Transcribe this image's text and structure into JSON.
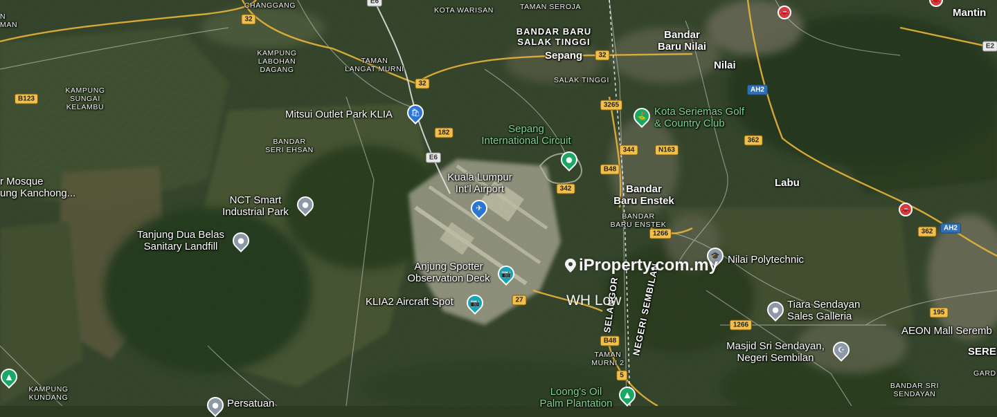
{
  "map": {
    "type": "satellite",
    "watermark": "iProperty.com.my",
    "author": "WH Low",
    "colors": {
      "forest": "#22351e",
      "plantation": "#3b4a2a",
      "urban": "#8c8a78",
      "airport": "#c9c4b0",
      "road_major": "#f2c04a",
      "road_minor": "#d8d8d8",
      "brand_blue": "#2a76d2"
    },
    "places": {
      "changgang": "CHANGGANG",
      "kota_warisan": "KOTA WARISAN",
      "taman_seroja": "TAMAN SEROJA",
      "bandar_baru_salak_tinggi": "BANDAR BARU\nSALAK TINGGI",
      "sepang": "Sepang",
      "salak_tinggi": "SALAK TINGGI",
      "bandar_baru_nilai": "Bandar\nBaru Nilai",
      "nilai": "Nilai",
      "mantin": "Mantin",
      "kampung_labohan_dagang": "KAMPUNG\nLABOHAN\nDAGANG",
      "taman_langat_murni": "TAMAN\nLANGAT MURNI",
      "kampung_sungai_kelambu": "KAMPUNG\nSUNGAI\nKELAMBU",
      "bandar_seri_ehsan": "BANDAR\nSERI EHSAN",
      "mosque_partial": "r Mosque\nung Kanchong...",
      "bandar_baru_enstek_big": "Bandar\nBaru Enstek",
      "bandar_baru_enstek_small": "BANDAR\nBARU ENSTEK",
      "labu": "Labu",
      "taman_murni_2": "TAMAN\nMURNI 2",
      "kampung_kundang": "KAMPUNG\nKUNDANG",
      "bandar_sri_sendayan": "BANDAR SRI\nSENDAYAN",
      "seremban_partial": "SERE",
      "gard_partial": "GARD",
      "persatuan_partial": "Persatuan",
      "selangor": "SELANGOR",
      "negeri_sembilan": "NEGERI SEMBILAN",
      "man_partial": "N\nMAN"
    },
    "pois": {
      "mitsui": "Mitsui Outlet Park KLIA",
      "sepang_circuit": "Sepang\nInternational Circuit",
      "kota_seriemas": "Kota Seriemas Golf\n& Country Club",
      "klia": "Kuala Lumpur\nInt'l Airport",
      "nct": "NCT Smart\nIndustrial Park",
      "tanjung": "Tanjung Dua Belas\nSanitary Landfill",
      "anjung": "Anjung Spotter\nObservation Deck",
      "klia2": "KLIA2 Aircraft Spot",
      "nilai_poly": "Nilai Polytechnic",
      "tiara": "Tiara Sendayan\nSales Galleria",
      "masjid": "Masjid Sri Sendayan,\nNegeri Sembilan",
      "aeon": "AEON Mall Seremb",
      "loongs": "Loong's Oil\nPalm Plantation"
    },
    "roads": {
      "r32a": "32",
      "r32b": "32",
      "r32c": "32",
      "r182": "182",
      "e6": "E6",
      "b123": "B123",
      "r3265": "3265",
      "r344": "344",
      "n163": "N163",
      "b48a": "B48",
      "b48b": "B48",
      "r342": "342",
      "r1266a": "1266",
      "r1266b": "1266",
      "r27": "27",
      "r5": "5",
      "r362a": "362",
      "r362b": "362",
      "ah2a": "AH2",
      "ah2b": "AH2",
      "r195": "195",
      "e2": "E2",
      "e_top": "E6"
    },
    "icons": {
      "shopping": "shopping-bag-icon",
      "airport": "airplane-icon",
      "golf": "golf-icon",
      "camera": "camera-icon",
      "school": "school-icon",
      "mosque": "mosque-icon",
      "tree": "tree-icon",
      "car": "car-icon"
    }
  }
}
